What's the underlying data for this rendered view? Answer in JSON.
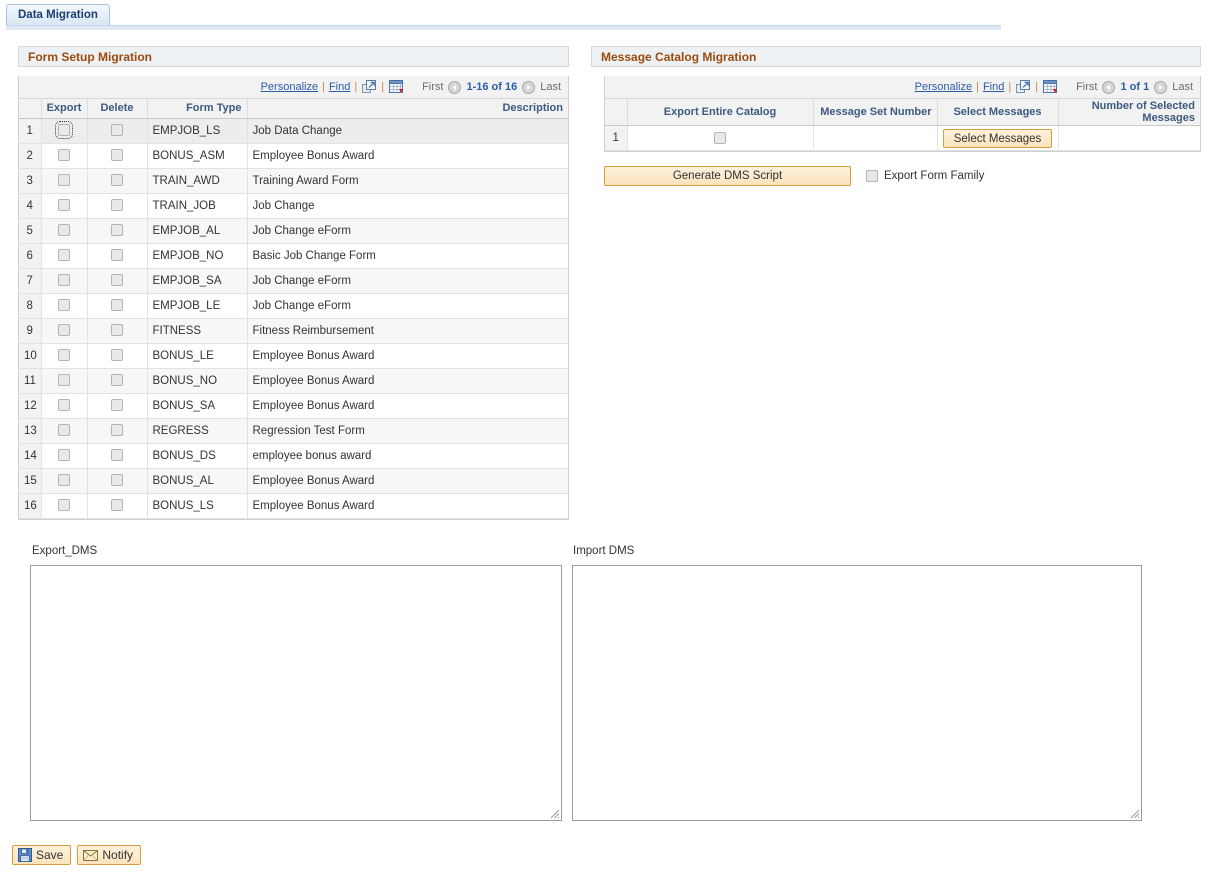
{
  "tab": {
    "label": "Data Migration"
  },
  "form_setup_panel": {
    "title": "Form Setup Migration",
    "toolbar": {
      "personalize": "Personalize",
      "find": "Find",
      "sep": "|",
      "expand_icon": "expand-window-icon",
      "download_icon": "download-to-spreadsheet-icon",
      "first": "First",
      "prev_icon": "previous-page-icon",
      "range": "1-16 of 16",
      "next_icon": "next-page-icon",
      "last": "Last"
    },
    "columns": [
      "",
      "Export",
      "Delete",
      "Form Type",
      "Description"
    ],
    "rows": [
      {
        "num": "1",
        "form_type": "EMPJOB_LS",
        "description": "Job Data Change",
        "export": false,
        "delete": false,
        "focused": true
      },
      {
        "num": "2",
        "form_type": "BONUS_ASM",
        "description": "Employee Bonus Award",
        "export": false,
        "delete": false,
        "focused": false
      },
      {
        "num": "3",
        "form_type": "TRAIN_AWD",
        "description": "Training Award Form",
        "export": false,
        "delete": false,
        "focused": false
      },
      {
        "num": "4",
        "form_type": "TRAIN_JOB",
        "description": "Job Change",
        "export": false,
        "delete": false,
        "focused": false
      },
      {
        "num": "5",
        "form_type": "EMPJOB_AL",
        "description": "Job Change eForm",
        "export": false,
        "delete": false,
        "focused": false
      },
      {
        "num": "6",
        "form_type": "EMPJOB_NO",
        "description": "Basic Job Change Form",
        "export": false,
        "delete": false,
        "focused": false
      },
      {
        "num": "7",
        "form_type": "EMPJOB_SA",
        "description": "Job Change eForm",
        "export": false,
        "delete": false,
        "focused": false
      },
      {
        "num": "8",
        "form_type": "EMPJOB_LE",
        "description": "Job Change eForm",
        "export": false,
        "delete": false,
        "focused": false
      },
      {
        "num": "9",
        "form_type": "FITNESS",
        "description": "Fitness Reimbursement",
        "export": false,
        "delete": false,
        "focused": false
      },
      {
        "num": "10",
        "form_type": "BONUS_LE",
        "description": "Employee Bonus Award",
        "export": false,
        "delete": false,
        "focused": false
      },
      {
        "num": "11",
        "form_type": "BONUS_NO",
        "description": "Employee Bonus Award",
        "export": false,
        "delete": false,
        "focused": false
      },
      {
        "num": "12",
        "form_type": "BONUS_SA",
        "description": "Employee Bonus Award",
        "export": false,
        "delete": false,
        "focused": false
      },
      {
        "num": "13",
        "form_type": "REGRESS",
        "description": "Regression Test Form",
        "export": false,
        "delete": false,
        "focused": false
      },
      {
        "num": "14",
        "form_type": "BONUS_DS",
        "description": "employee bonus award",
        "export": false,
        "delete": false,
        "focused": false
      },
      {
        "num": "15",
        "form_type": "BONUS_AL",
        "description": "Employee Bonus Award",
        "export": false,
        "delete": false,
        "focused": false
      },
      {
        "num": "16",
        "form_type": "BONUS_LS",
        "description": "Employee Bonus Award",
        "export": false,
        "delete": false,
        "focused": false
      }
    ]
  },
  "message_catalog_panel": {
    "title": "Message Catalog Migration",
    "toolbar": {
      "personalize": "Personalize",
      "find": "Find",
      "sep": "|",
      "expand_icon": "expand-window-icon",
      "download_icon": "download-to-spreadsheet-icon",
      "first": "First",
      "prev_icon": "previous-page-icon",
      "range": "1 of 1",
      "next_icon": "next-page-icon",
      "last": "Last"
    },
    "columns": [
      "",
      "Export Entire Catalog",
      "Message Set Number",
      "Select Messages",
      "Number of Selected Messages"
    ],
    "rows": [
      {
        "num": "1",
        "export_entire_catalog": false,
        "message_set_number": "",
        "select_messages_button": "Select Messages",
        "number_of_selected_messages": ""
      }
    ],
    "generate_button": "Generate DMS Script",
    "export_form_family_label": "Export Form Family",
    "export_form_family_checked": false
  },
  "export_dms": {
    "label": "Export_DMS",
    "value": ""
  },
  "import_dms": {
    "label": "Import DMS",
    "value": ""
  },
  "bottom_toolbar": {
    "save_label": "Save",
    "save_icon": "floppy-disk-icon",
    "notify_label": "Notify",
    "notify_icon": "envelope-icon"
  },
  "colors": {
    "panel_title_text": "#9a4b10",
    "link": "#2b5ca8",
    "column_header_text": "#3d5a80",
    "button_border": "#d79d3c",
    "tab_text": "#1c3f70"
  }
}
